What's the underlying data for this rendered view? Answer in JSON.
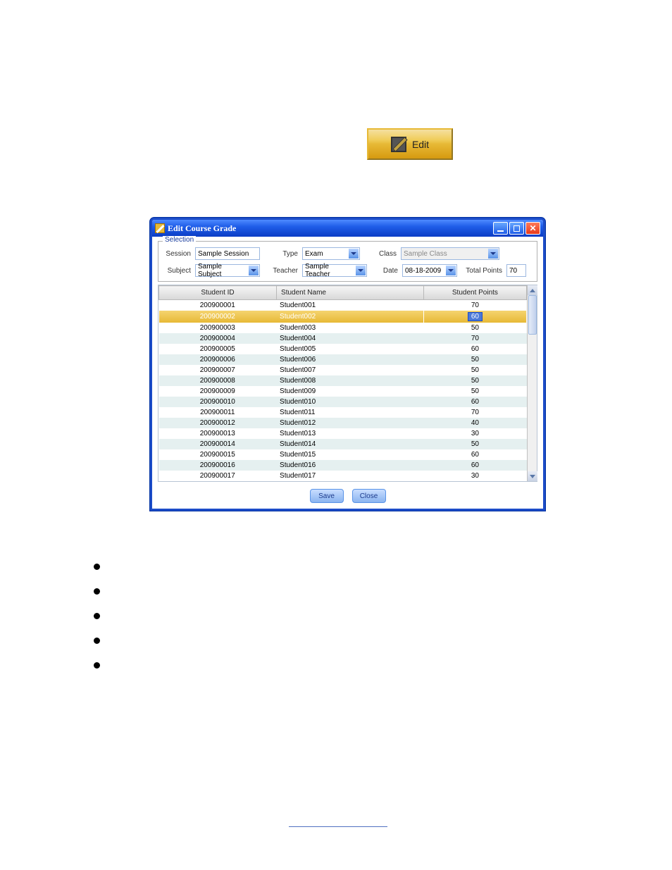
{
  "edit_button_label": "Edit",
  "window": {
    "title": "Edit Course Grade"
  },
  "selection": {
    "legend": "Selection",
    "labels": {
      "session": "Session",
      "type": "Type",
      "class": "Class",
      "subject": "Subject",
      "teacher": "Teacher",
      "date": "Date",
      "total_points": "Total Points"
    },
    "values": {
      "session": "Sample Session",
      "type": "Exam",
      "class": "Sample Class",
      "subject": "Sample Subject",
      "teacher": "Sample Teacher",
      "date": "08-18-2009",
      "total_points": "70"
    }
  },
  "table": {
    "headers": {
      "id": "Student ID",
      "name": "Student Name",
      "points": "Student Points"
    },
    "rows": [
      {
        "id": "200900001",
        "name": "Student001",
        "points": "70",
        "selected": false
      },
      {
        "id": "200900002",
        "name": "Student002",
        "points": "60",
        "selected": true
      },
      {
        "id": "200900003",
        "name": "Student003",
        "points": "50",
        "selected": false
      },
      {
        "id": "200900004",
        "name": "Student004",
        "points": "70",
        "selected": false
      },
      {
        "id": "200900005",
        "name": "Student005",
        "points": "60",
        "selected": false
      },
      {
        "id": "200900006",
        "name": "Student006",
        "points": "50",
        "selected": false
      },
      {
        "id": "200900007",
        "name": "Student007",
        "points": "50",
        "selected": false
      },
      {
        "id": "200900008",
        "name": "Student008",
        "points": "50",
        "selected": false
      },
      {
        "id": "200900009",
        "name": "Student009",
        "points": "50",
        "selected": false
      },
      {
        "id": "200900010",
        "name": "Student010",
        "points": "60",
        "selected": false
      },
      {
        "id": "200900011",
        "name": "Student011",
        "points": "70",
        "selected": false
      },
      {
        "id": "200900012",
        "name": "Student012",
        "points": "40",
        "selected": false
      },
      {
        "id": "200900013",
        "name": "Student013",
        "points": "30",
        "selected": false
      },
      {
        "id": "200900014",
        "name": "Student014",
        "points": "50",
        "selected": false
      },
      {
        "id": "200900015",
        "name": "Student015",
        "points": "60",
        "selected": false
      },
      {
        "id": "200900016",
        "name": "Student016",
        "points": "60",
        "selected": false
      },
      {
        "id": "200900017",
        "name": "Student017",
        "points": "30",
        "selected": false
      }
    ]
  },
  "buttons": {
    "save": "Save",
    "close": "Close"
  }
}
